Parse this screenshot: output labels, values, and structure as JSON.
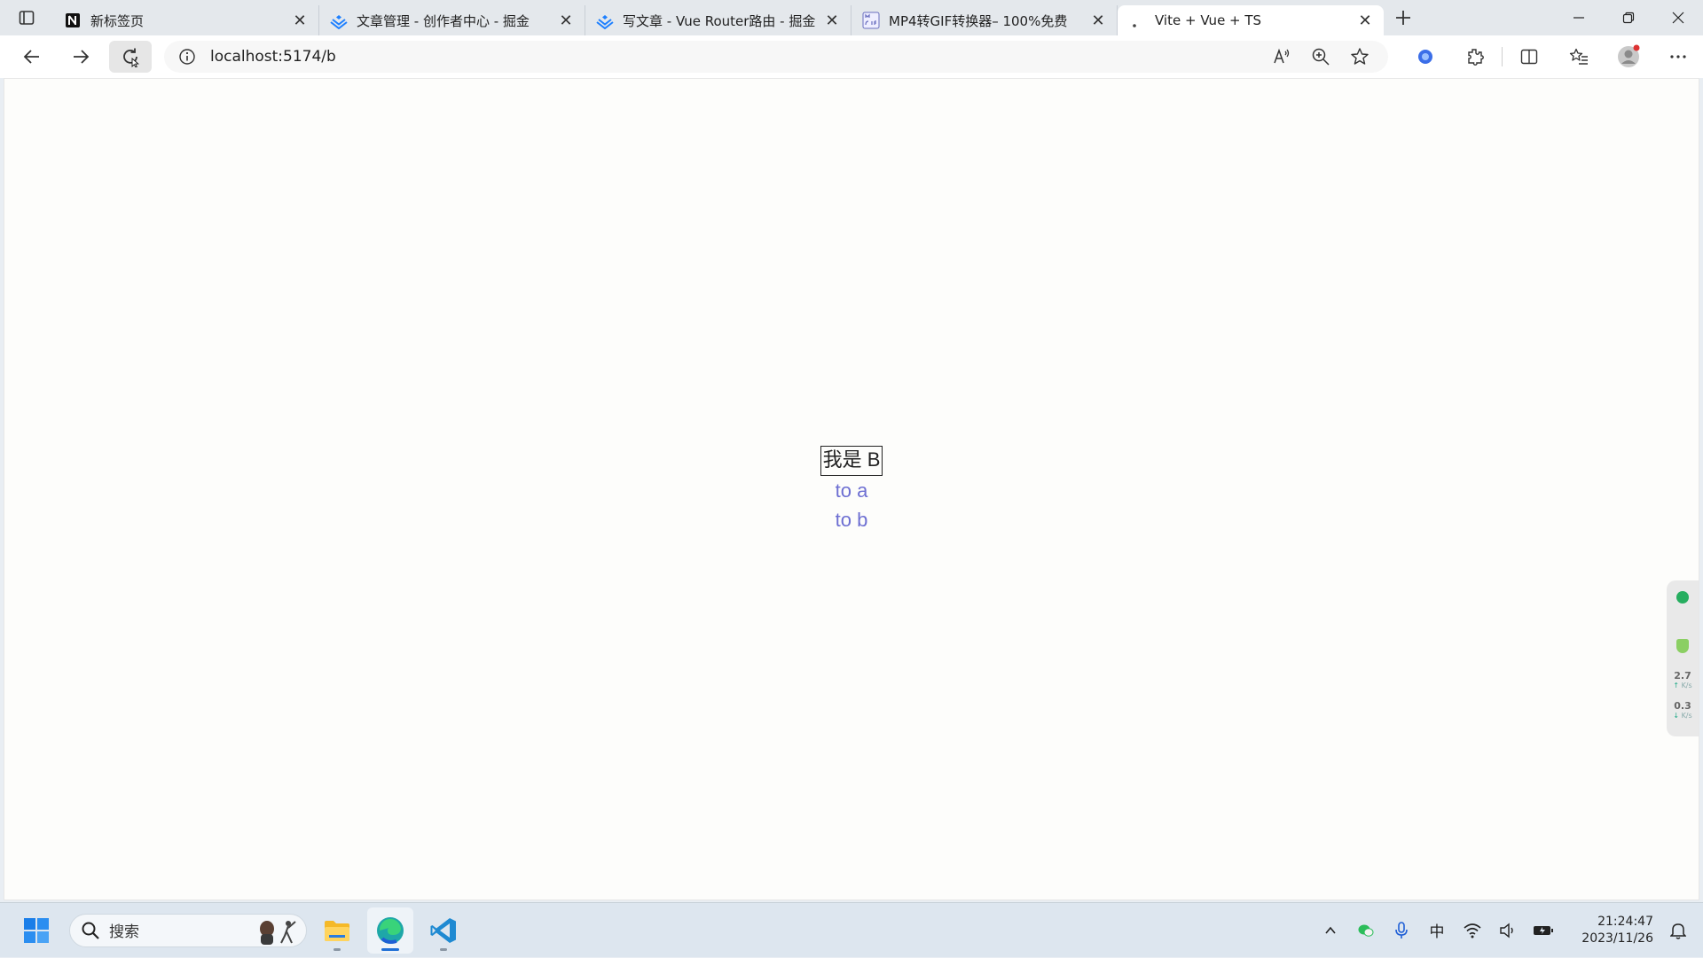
{
  "browser": {
    "tabs": [
      {
        "title": "新标签页",
        "favicon": "notion-icon"
      },
      {
        "title": "文章管理 - 创作者中心 - 掘金",
        "favicon": "juejin-icon"
      },
      {
        "title": "写文章 - Vue Router路由 - 掘金",
        "favicon": "juejin-icon"
      },
      {
        "title": "MP4转GIF转换器– 100%免费",
        "favicon": "mp4gif-icon"
      },
      {
        "title": "Vite + Vue + TS",
        "favicon": "dot-icon",
        "active": true
      }
    ],
    "address": {
      "url": "localhost:5174/b"
    }
  },
  "page": {
    "heading": "我是 B",
    "links": [
      {
        "label": "to a"
      },
      {
        "label": "to b"
      }
    ]
  },
  "side_widget": {
    "upload_value": "2.7",
    "upload_unit": "K/s",
    "download_value": "0.3",
    "download_unit": "K/s"
  },
  "taskbar": {
    "search_placeholder": "搜索",
    "ime_label": "中",
    "time": "21:24:47",
    "date": "2023/11/26"
  },
  "colors": {
    "link": "#6d6fd2",
    "accent": "#1f6fd6",
    "widget_green": "#27ae60"
  }
}
